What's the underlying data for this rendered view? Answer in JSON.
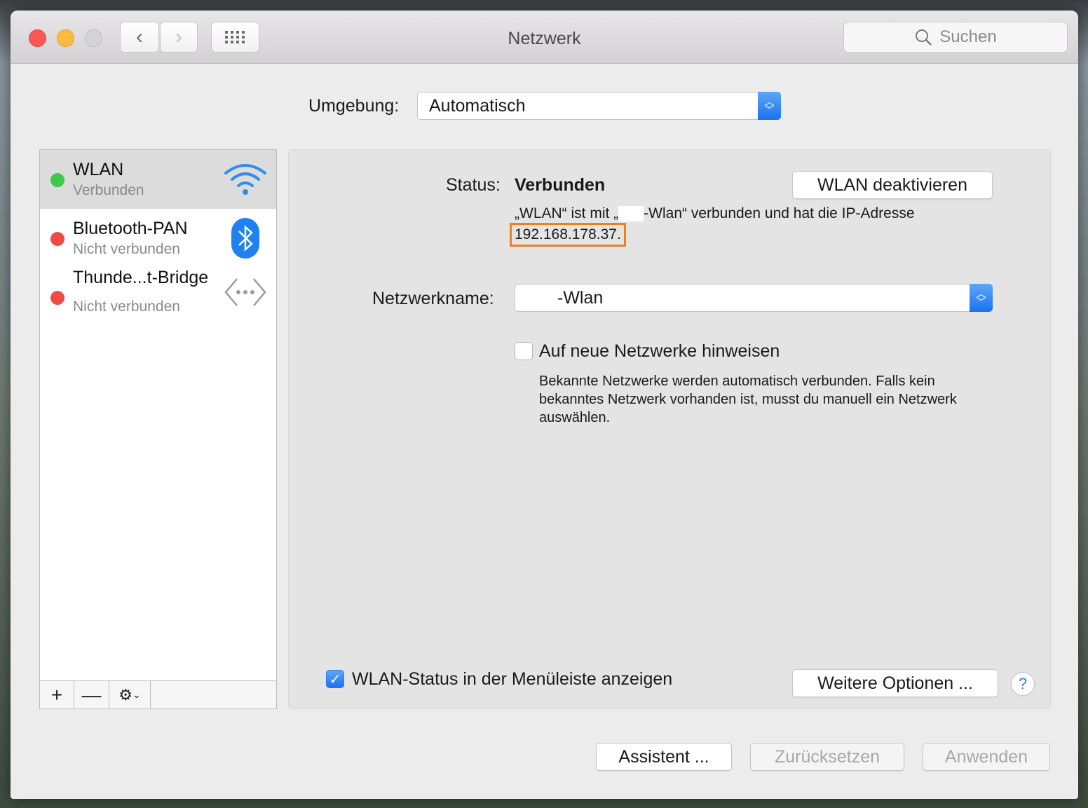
{
  "window": {
    "title": "Netzwerk",
    "search_placeholder": "Suchen"
  },
  "location": {
    "label": "Umgebung:",
    "value": "Automatisch"
  },
  "services": [
    {
      "name": "WLAN",
      "status": "Verbunden",
      "status_color": "#3fc94a",
      "icon": "wifi-icon"
    },
    {
      "name": "Bluetooth-PAN",
      "status": "Nicht verbunden",
      "status_color": "#f04c45",
      "icon": "bluetooth-icon"
    },
    {
      "name": "Thunde...t-Bridge",
      "status": "Nicht verbunden",
      "status_color": "#f04c45",
      "icon": "thunderbolt-bridge-icon"
    }
  ],
  "sidebar_toolbar": {
    "add": "+",
    "remove": "—"
  },
  "detail": {
    "status_label": "Status:",
    "status_value": "Verbunden",
    "toggle_button": "WLAN deaktivieren",
    "status_text_1": "„WLAN“ ist mit „",
    "status_text_2": "-Wlan“ verbunden und hat die IP-Adresse",
    "ip_address": "192.168.178.37.",
    "network_name_label": "Netzwerkname:",
    "network_name_value": "-Wlan",
    "ask_join_label": "Auf neue Netzwerke hinweisen",
    "ask_join_checked": false,
    "ask_join_help": "Bekannte Netzwerke werden automatisch verbunden. Falls kein bekanntes Netzwerk vorhanden ist, musst du manuell ein Netzwerk auswählen.",
    "menubar_label": "WLAN-Status in der Menüleiste anzeigen",
    "menubar_checked": true,
    "advanced_button": "Weitere Optionen ...",
    "help": "?"
  },
  "footer": {
    "assistant": "Assistent ...",
    "revert": "Zurücksetzen",
    "apply": "Anwenden"
  },
  "colors": {
    "accent": "#1a72ef",
    "highlight": "#f47c20"
  }
}
